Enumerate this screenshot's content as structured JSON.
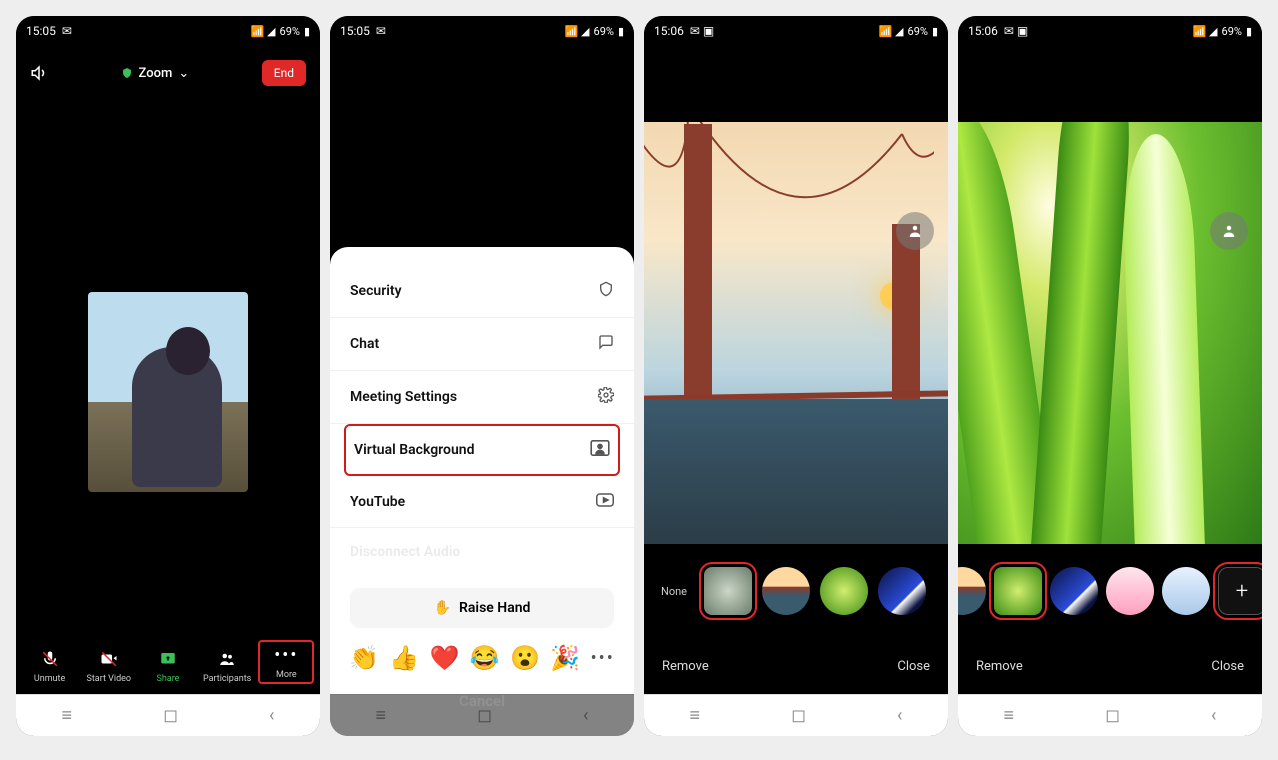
{
  "status": {
    "time1": "15:05",
    "time2": "15:05",
    "time3": "15:06",
    "time4": "15:06",
    "batt": "69%"
  },
  "screen1": {
    "speaker_icon": "speaker-icon",
    "shield_icon": "shield-icon",
    "title": "Zoom",
    "end": "End",
    "tools": {
      "unmute": "Unmute",
      "startVideo": "Start Video",
      "share": "Share",
      "participants": "Participants",
      "more": "More"
    }
  },
  "screen2": {
    "menu": {
      "security": "Security",
      "chat": "Chat",
      "meetingSettings": "Meeting Settings",
      "virtualBackground": "Virtual Background",
      "youtube": "YouTube",
      "disconnect": "Disconnect Audio"
    },
    "raiseHand": "Raise Hand",
    "emojis": [
      "👏",
      "👍",
      "❤️",
      "😂",
      "😮",
      "🎉"
    ],
    "cancel": "Cancel"
  },
  "vb": {
    "none": "None",
    "blur": "Blur",
    "remove": "Remove",
    "close": "Close",
    "plus": "+",
    "thumbs3": [
      "blur",
      "bridge",
      "grass",
      "space"
    ],
    "thumbs4": [
      "bridge",
      "grass",
      "space",
      "pink",
      "sky"
    ]
  }
}
